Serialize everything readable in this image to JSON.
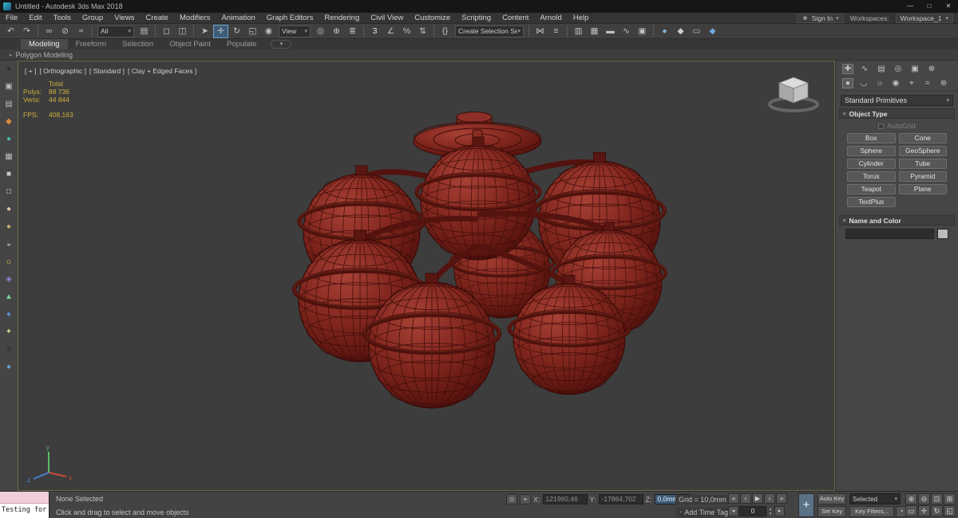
{
  "colors": {
    "viewport_bg": "#3d3d3d",
    "model_red": "#7d241c",
    "stats_yellow": "#d2ae3e",
    "active_tool_blue": "#3e5c78"
  },
  "title_bar": {
    "title": "Untitled - Autodesk 3ds Max 2018",
    "minimize": "—",
    "maximize": "□",
    "close": "✕"
  },
  "menu_bar": {
    "items": [
      "File",
      "Edit",
      "Tools",
      "Group",
      "Views",
      "Create",
      "Modifiers",
      "Animation",
      "Graph Editors",
      "Rendering",
      "Civil View",
      "Customize",
      "Scripting",
      "Content",
      "Arnold",
      "Help"
    ],
    "sign_in": "Sign In",
    "workspaces_label": "Workspaces:",
    "workspace_value": "Workspace_1"
  },
  "toolbar": {
    "items": [
      {
        "t": "icon",
        "name": "undo-icon",
        "glyph": "↶"
      },
      {
        "t": "icon",
        "name": "redo-icon",
        "glyph": "↷"
      },
      {
        "t": "sep"
      },
      {
        "t": "icon",
        "name": "select-and-link-icon",
        "glyph": "∞"
      },
      {
        "t": "icon",
        "name": "unlink-selection-icon",
        "glyph": "⊘"
      },
      {
        "t": "icon",
        "name": "bind-to-space-warp-icon",
        "glyph": "≈"
      },
      {
        "t": "sep"
      },
      {
        "t": "dropdown",
        "name": "selection-filter-dropdown",
        "value": "All",
        "w": 46
      },
      {
        "t": "icon",
        "name": "select-by-name-icon",
        "glyph": "▤"
      },
      {
        "t": "sep"
      },
      {
        "t": "icon",
        "name": "rectangular-selection-region-icon",
        "glyph": "◻"
      },
      {
        "t": "icon",
        "name": "window-crossing-icon",
        "glyph": "◫"
      },
      {
        "t": "sep"
      },
      {
        "t": "icon",
        "name": "select-object-icon",
        "glyph": "➤"
      },
      {
        "t": "icon",
        "name": "select-and-move-icon",
        "glyph": "✛",
        "active": true
      },
      {
        "t": "icon",
        "name": "select-and-rotate-icon",
        "glyph": "↻"
      },
      {
        "t": "icon",
        "name": "select-and-scale-icon",
        "glyph": "◱"
      },
      {
        "t": "icon",
        "name": "select-placement-icon",
        "glyph": "◉"
      },
      {
        "t": "dropdown",
        "name": "reference-coordinate-dropdown",
        "value": "View",
        "w": 40
      },
      {
        "t": "icon",
        "name": "use-pivot-point-icon",
        "glyph": "◎"
      },
      {
        "t": "icon",
        "name": "select-and-manipulate-icon",
        "glyph": "⊕"
      },
      {
        "t": "icon",
        "name": "keyboard-override-icon",
        "glyph": "≣"
      },
      {
        "t": "sep"
      },
      {
        "t": "icon",
        "name": "snaps-toggle-icon",
        "glyph": "3",
        "color": "#e0e0e0"
      },
      {
        "t": "icon",
        "name": "angle-snap-icon",
        "glyph": "∠"
      },
      {
        "t": "icon",
        "name": "percent-snap-icon",
        "glyph": "%"
      },
      {
        "t": "icon",
        "name": "spinner-snap-icon",
        "glyph": "⇅"
      },
      {
        "t": "sep"
      },
      {
        "t": "icon",
        "name": "named-selection-sets-icon",
        "glyph": "{}"
      },
      {
        "t": "dropdown",
        "name": "named-selection-set-dropdown",
        "value": "Create Selection Se",
        "w": 86
      },
      {
        "t": "sep"
      },
      {
        "t": "icon",
        "name": "mirror-icon",
        "glyph": "⋈"
      },
      {
        "t": "icon",
        "name": "align-icon",
        "glyph": "≡"
      },
      {
        "t": "sep"
      },
      {
        "t": "icon",
        "name": "toggle-scene-explorer-icon",
        "glyph": "▥"
      },
      {
        "t": "icon",
        "name": "toggle-layer-explorer-icon",
        "glyph": "▦"
      },
      {
        "t": "icon",
        "name": "toggle-ribbon-icon",
        "glyph": "▬"
      },
      {
        "t": "icon",
        "name": "curve-editor-icon",
        "glyph": "∿"
      },
      {
        "t": "icon",
        "name": "schematic-view-icon",
        "glyph": "▣"
      },
      {
        "t": "sep"
      },
      {
        "t": "icon",
        "name": "material-editor-icon",
        "glyph": "●",
        "color": "#7fb2d9"
      },
      {
        "t": "icon",
        "name": "render-setup-icon",
        "glyph": "◆",
        "color": "#cfcfcf"
      },
      {
        "t": "icon",
        "name": "rendered-frame-icon",
        "glyph": "▭"
      },
      {
        "t": "icon",
        "name": "render-production-icon",
        "glyph": "◆",
        "color": "#6fa8dc"
      }
    ]
  },
  "left_dock": {
    "items": [
      {
        "name": "dock-launcher-icon",
        "glyph": "●",
        "color": "#2e2e2e"
      },
      {
        "name": "dock-icon-2",
        "glyph": "▣",
        "color": "#bdbdbd"
      },
      {
        "name": "dock-icon-3",
        "glyph": "▤",
        "color": "#bdbdbd"
      },
      {
        "name": "dock-icon-4",
        "glyph": "◆",
        "color": "#d98a3a"
      },
      {
        "name": "dock-icon-5",
        "glyph": "●",
        "color": "#4fb6b0"
      },
      {
        "name": "dock-icon-6",
        "glyph": "▦",
        "color": "#bdbdbd"
      },
      {
        "name": "dock-icon-7",
        "glyph": "■",
        "color": "#c9c9c9"
      },
      {
        "name": "dock-icon-8",
        "glyph": "□",
        "color": "#e8e8e8"
      },
      {
        "name": "dock-icon-9",
        "glyph": "●",
        "color": "#d8c49a"
      },
      {
        "name": "dock-icon-10",
        "glyph": "●",
        "color": "#c9a86a"
      },
      {
        "name": "dock-icon-11",
        "glyph": "◒",
        "color": "#b0b0b0"
      },
      {
        "name": "dock-icon-12",
        "glyph": "☼",
        "color": "#e3c94f"
      },
      {
        "name": "dock-icon-13",
        "glyph": "◈",
        "color": "#9a7fd1"
      },
      {
        "name": "dock-icon-14",
        "glyph": "▲",
        "color": "#7fd19a"
      },
      {
        "name": "dock-icon-15",
        "glyph": "●",
        "color": "#5a8fd1"
      },
      {
        "name": "dock-icon-16",
        "glyph": "✦",
        "color": "#d1d17f"
      },
      {
        "name": "dock-icon-17",
        "glyph": "■",
        "color": "#383838"
      },
      {
        "name": "dock-icon-18",
        "glyph": "●",
        "color": "#6aa0c8"
      }
    ]
  },
  "ribbon": {
    "tabs": [
      {
        "label": "Modeling",
        "active": true
      },
      {
        "label": "Freeform"
      },
      {
        "label": "Selection"
      },
      {
        "label": "Object Paint"
      },
      {
        "label": "Populate"
      }
    ],
    "display_toggle": "▾",
    "panel_label": "Polygon Modeling"
  },
  "viewport": {
    "label_segments": [
      "[ + ]",
      "[ Orthographic ]",
      "[ Standard ]",
      "[ Clay + Edged Faces ]"
    ],
    "stats": {
      "total_label": "Total",
      "polys_label": "Polys:",
      "polys": "88 736",
      "verts_label": "Verts:",
      "verts": "44 844",
      "fps_label": "FPS:",
      "fps": "408,163"
    },
    "axis": {
      "x": "x",
      "y": "y",
      "z": "z"
    }
  },
  "command_panel": {
    "tabs": [
      {
        "name": "create-tab-icon",
        "glyph": "✚",
        "active": true
      },
      {
        "name": "modify-tab-icon",
        "glyph": "∿"
      },
      {
        "name": "hierarchy-tab-icon",
        "glyph": "▤"
      },
      {
        "name": "motion-tab-icon",
        "glyph": "◎"
      },
      {
        "name": "display-tab-icon",
        "glyph": "▣"
      },
      {
        "name": "utilities-tab-icon",
        "glyph": "⊗"
      }
    ],
    "subtabs": [
      {
        "name": "geometry-icon",
        "glyph": "●",
        "active": true
      },
      {
        "name": "shapes-icon",
        "glyph": "◡"
      },
      {
        "name": "lights-icon",
        "glyph": "☼"
      },
      {
        "name": "cameras-icon",
        "glyph": "◉"
      },
      {
        "name": "helpers-icon",
        "glyph": "⌖"
      },
      {
        "name": "space-warps-icon",
        "glyph": "≈"
      },
      {
        "name": "systems-icon",
        "glyph": "⊛"
      }
    ],
    "category_dropdown": "Standard Primitives",
    "object_type": {
      "title": "Object Type",
      "autogrid": "AutoGrid",
      "buttons": [
        "Box",
        "Cone",
        "Sphere",
        "GeoSphere",
        "Cylinder",
        "Tube",
        "Torus",
        "Pyramid",
        "Teapot",
        "Plane",
        "TextPlus"
      ]
    },
    "name_color": {
      "title": "Name and Color"
    }
  },
  "status_bar": {
    "listener_text": "Testing for i",
    "selection_status": "None Selected",
    "prompt": "Click and drag to select and move objects",
    "lock_glyph": "⊙",
    "absolute_mode_glyph": "⌖",
    "coords": {
      "x_label": "X:",
      "x_value": "121960,46",
      "y_label": "Y:",
      "y_value": "-17864,702",
      "z_label": "Z:",
      "z_value": "0,0mm"
    },
    "grid_label": "Grid = 10,0mm",
    "time_tag": "Add Time Tag",
    "playback": [
      {
        "name": "go-to-start-icon",
        "glyph": "«"
      },
      {
        "name": "previous-frame-icon",
        "glyph": "‹"
      },
      {
        "name": "play-icon",
        "glyph": "▶"
      },
      {
        "name": "next-frame-icon",
        "glyph": "›"
      },
      {
        "name": "go-to-end-icon",
        "glyph": "»"
      }
    ],
    "frame_value": "0",
    "set_keys_glyph": "+",
    "auto_key": "Auto Key",
    "set_key": "Set Key",
    "selection_set_value": "Selected",
    "key_filters": "Key Filters...",
    "nav": [
      {
        "name": "zoom-icon",
        "glyph": "⊕"
      },
      {
        "name": "zoom-all-icon",
        "glyph": "⊖"
      },
      {
        "name": "zoom-extents-icon",
        "glyph": "⊡"
      },
      {
        "name": "zoom-extents-all-icon",
        "glyph": "⊞"
      },
      {
        "name": "zoom-region-icon",
        "glyph": "▭"
      },
      {
        "name": "pan-icon",
        "glyph": "✛"
      },
      {
        "name": "orbit-icon",
        "glyph": "↻"
      },
      {
        "name": "maximize-viewport-icon",
        "glyph": "◱"
      }
    ]
  }
}
